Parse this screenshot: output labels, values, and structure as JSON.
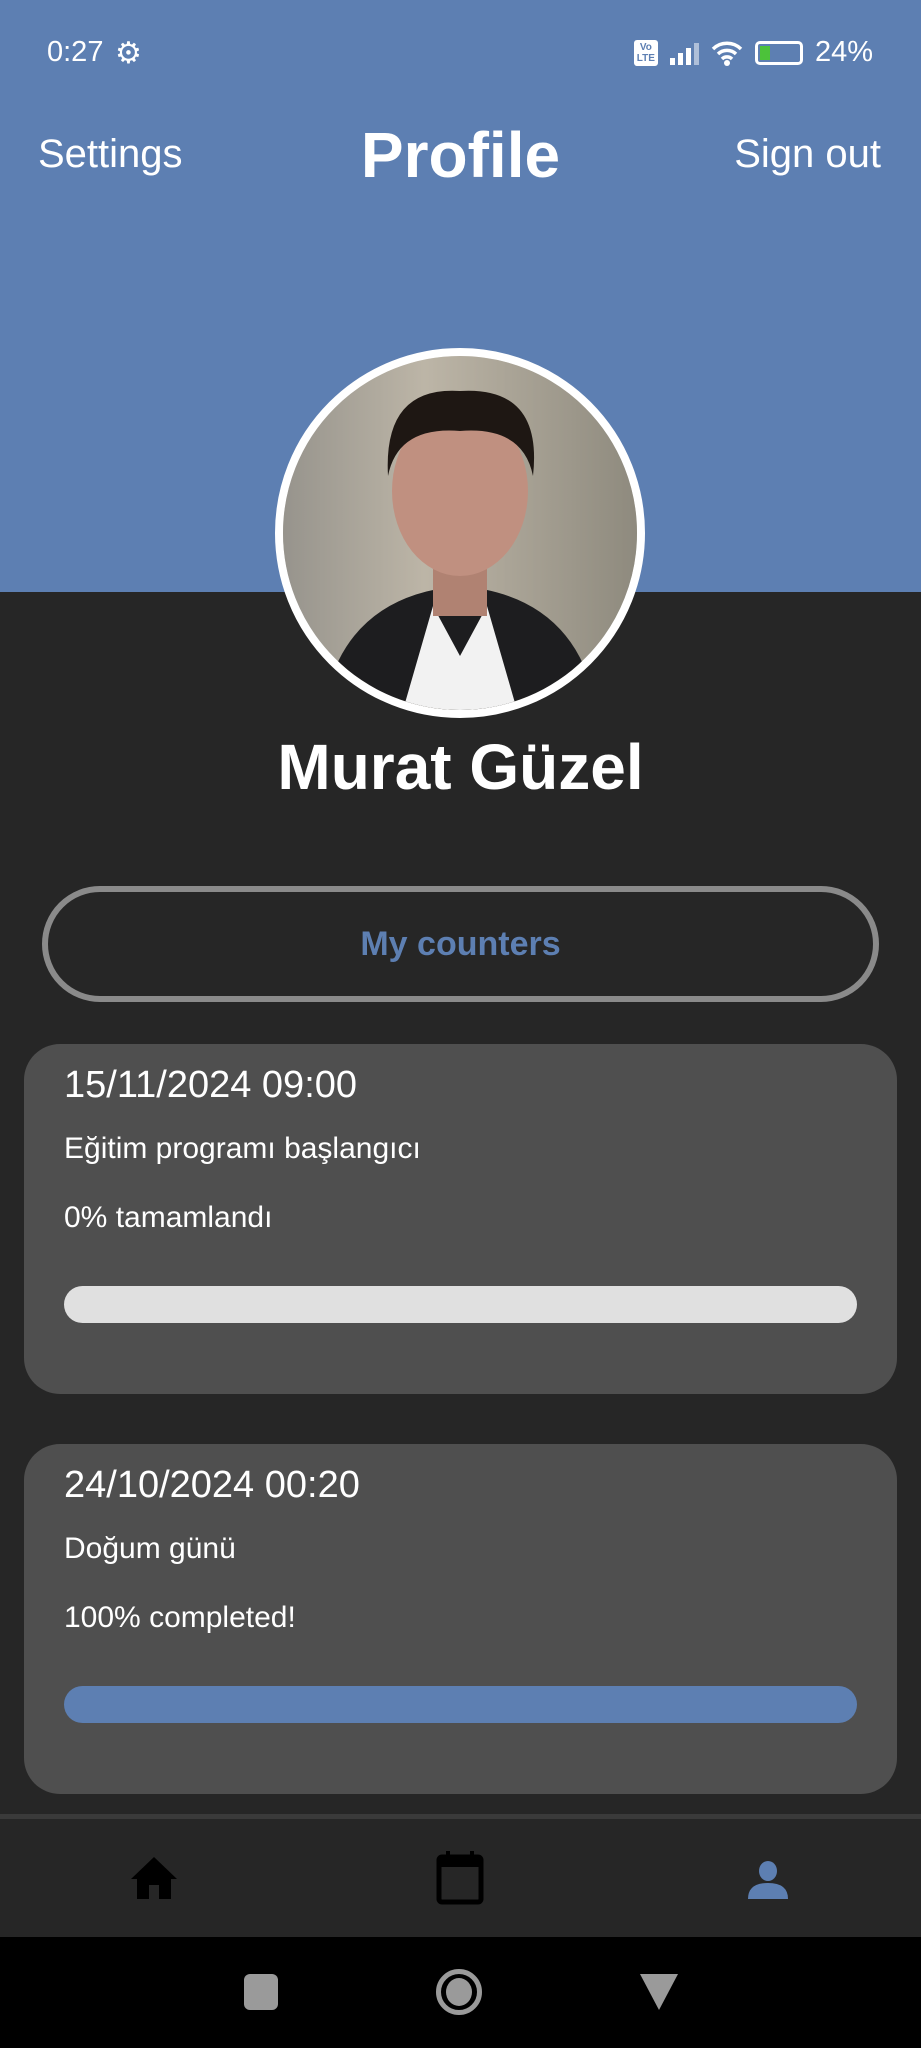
{
  "status_bar": {
    "time": "0:27",
    "battery": "24%"
  },
  "header": {
    "settings": "Settings",
    "title": "Profile",
    "sign_out": "Sign out"
  },
  "profile": {
    "name": "Murat Güzel"
  },
  "counters_button": "My counters",
  "counters": [
    {
      "date": "15/11/2024 09:00",
      "title": "Eğitim programı başlangıcı",
      "status": "0% tamamlandı",
      "progress": 0
    },
    {
      "date": "24/10/2024 00:20",
      "title": "Doğum günü",
      "status": "100% completed!",
      "progress": 100
    }
  ],
  "colors": {
    "accent": "#5d7fb2",
    "background": "#262626",
    "card": "#4f4f4f"
  }
}
